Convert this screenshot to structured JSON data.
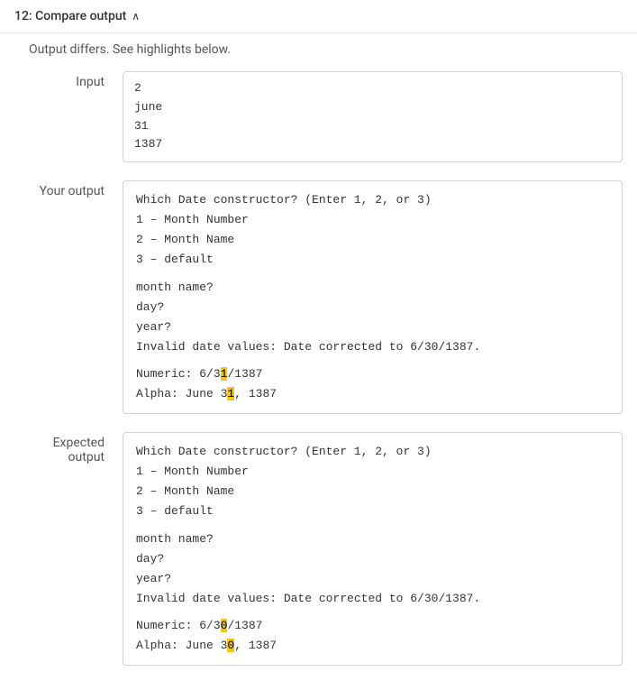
{
  "header": {
    "title": "12: Compare output",
    "chevron": "∧",
    "status": "Output differs. See highlights below."
  },
  "input": {
    "label": "Input",
    "lines": [
      "2",
      "june",
      "31",
      "1387"
    ]
  },
  "your_output": {
    "label": "Your output",
    "lines_top": [
      "Which Date constructor? (Enter 1, 2, or 3)",
      "1 – Month Number",
      "2 – Month Name",
      "3 – default"
    ],
    "lines_mid": [
      "month name?",
      "day?",
      "year?",
      "Invalid date values: Date corrected to 6/30/1387."
    ],
    "numeric_prefix": "Numeric: 6/3",
    "numeric_highlight": "1",
    "numeric_suffix": "/1387",
    "alpha_prefix": "Alpha:    June 3",
    "alpha_highlight": "1",
    "alpha_suffix": ", 1387"
  },
  "expected_output": {
    "label": "Expected output",
    "lines_top": [
      "Which Date constructor? (Enter 1, 2, or 3)",
      "1 – Month Number",
      "2 – Month Name",
      "3 – default"
    ],
    "lines_mid": [
      "month name?",
      "day?",
      "year?",
      "Invalid date values: Date corrected to 6/30/1387."
    ],
    "numeric_prefix": "Numeric: 6/3",
    "numeric_highlight": "0",
    "numeric_suffix": "/1387",
    "alpha_prefix": "Alpha:    June 3",
    "alpha_highlight": "0",
    "alpha_suffix": ", 1387"
  }
}
